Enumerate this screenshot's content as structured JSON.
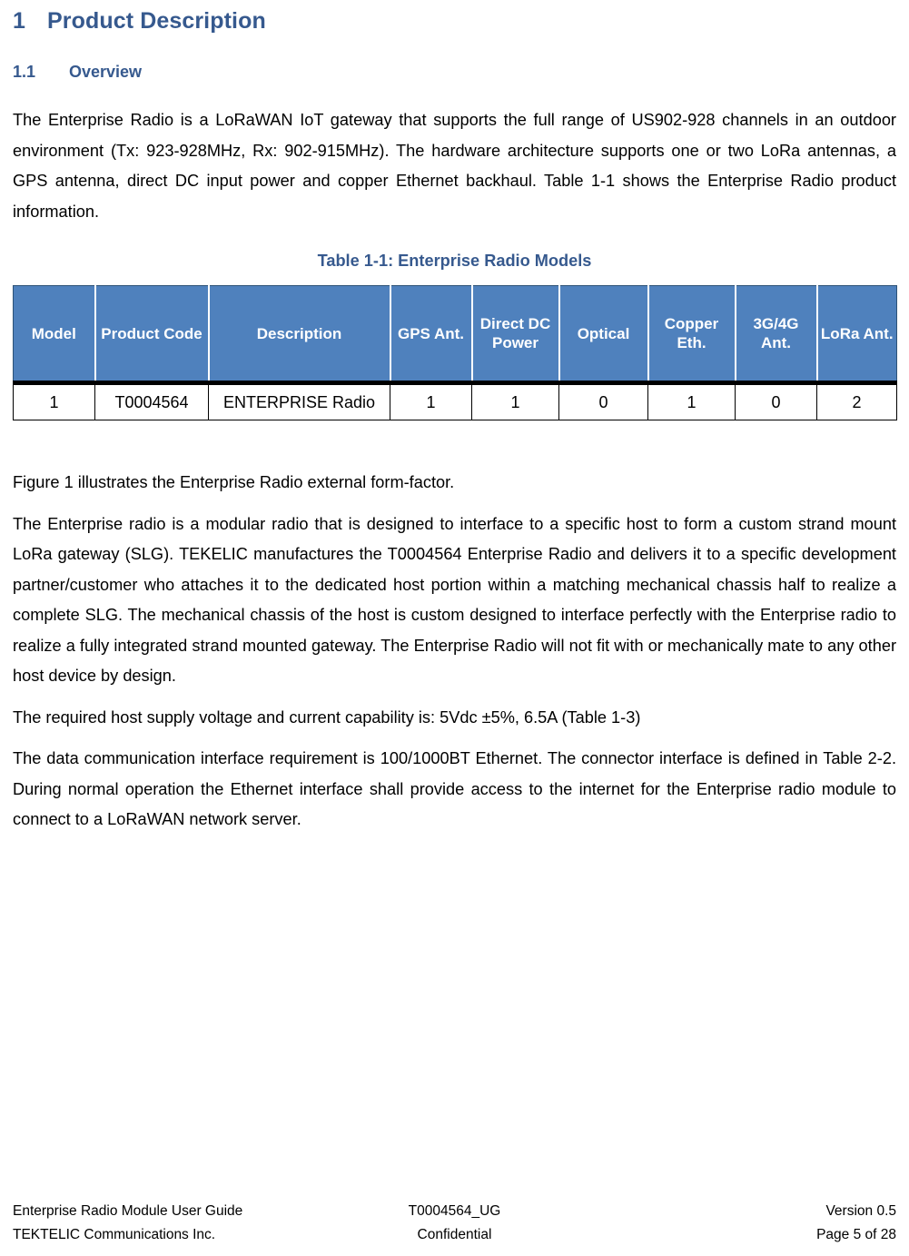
{
  "colors": {
    "heading_blue": "#36598E",
    "table_header_fill": "#4F81BD",
    "table_header_text": "#FFFFFF",
    "body_text": "#000000"
  },
  "headings": {
    "h1_number": "1",
    "h1_title": "Product Description",
    "h2_number": "1.1",
    "h2_title": "Overview"
  },
  "paragraphs": {
    "overview": "The Enterprise Radio is a LoRaWAN IoT gateway that supports the full range of US902-928 channels in an outdoor environment (Tx: 923-928MHz, Rx: 902-915MHz).   The hardware architecture supports one or two LoRa antennas, a GPS antenna, direct DC input power and copper Ethernet backhaul.  Table 1-1 shows the Enterprise Radio product information.",
    "figure_ref": "Figure 1 illustrates the Enterprise Radio external form-factor.",
    "modular_radio": "The Enterprise radio is a modular radio that is designed to interface to a specific host to form a custom strand mount LoRa gateway (SLG).   TEKELIC manufactures the T0004564 Enterprise Radio and delivers it to a specific development partner/customer who attaches it to the dedicated host portion within a matching mechanical chassis half to realize a complete SLG.  The mechanical chassis of the host is custom designed to interface perfectly with the Enterprise radio to realize a fully integrated strand mounted gateway.  The Enterprise Radio will not fit with or mechanically mate to any other host device by design.",
    "power": "The required host supply voltage and current capability is: 5Vdc ±5%, 6.5A (Table 1-3)",
    "data_interface": "The data communication interface requirement is 100/1000BT Ethernet.   The connector interface is defined in Table 2-2.  During normal operation the Ethernet interface shall provide access to the internet for the Enterprise radio module to connect to a LoRaWAN network server."
  },
  "table": {
    "caption": "Table 1-1: Enterprise Radio Models",
    "headers": [
      "Model",
      "Product Code",
      "Description",
      "GPS Ant.",
      "Direct DC Power",
      "Optical",
      "Copper Eth.",
      "3G/4G Ant.",
      "LoRa Ant."
    ],
    "rows": [
      {
        "model": "1",
        "product_code": "T0004564",
        "description": "ENTERPRISE Radio",
        "gps_ant": "1",
        "direct_dc_power": "1",
        "optical": "0",
        "copper_eth": "1",
        "three_four_g_ant": "0",
        "lora_ant": "2"
      }
    ]
  },
  "footer": {
    "line1_left": "Enterprise Radio Module User Guide",
    "line1_center": "T0004564_UG",
    "line1_right": "Version 0.5",
    "line2_left": "TEKTELIC Communications Inc.",
    "line2_center": "Confidential",
    "line2_right": "Page 5 of 28"
  }
}
